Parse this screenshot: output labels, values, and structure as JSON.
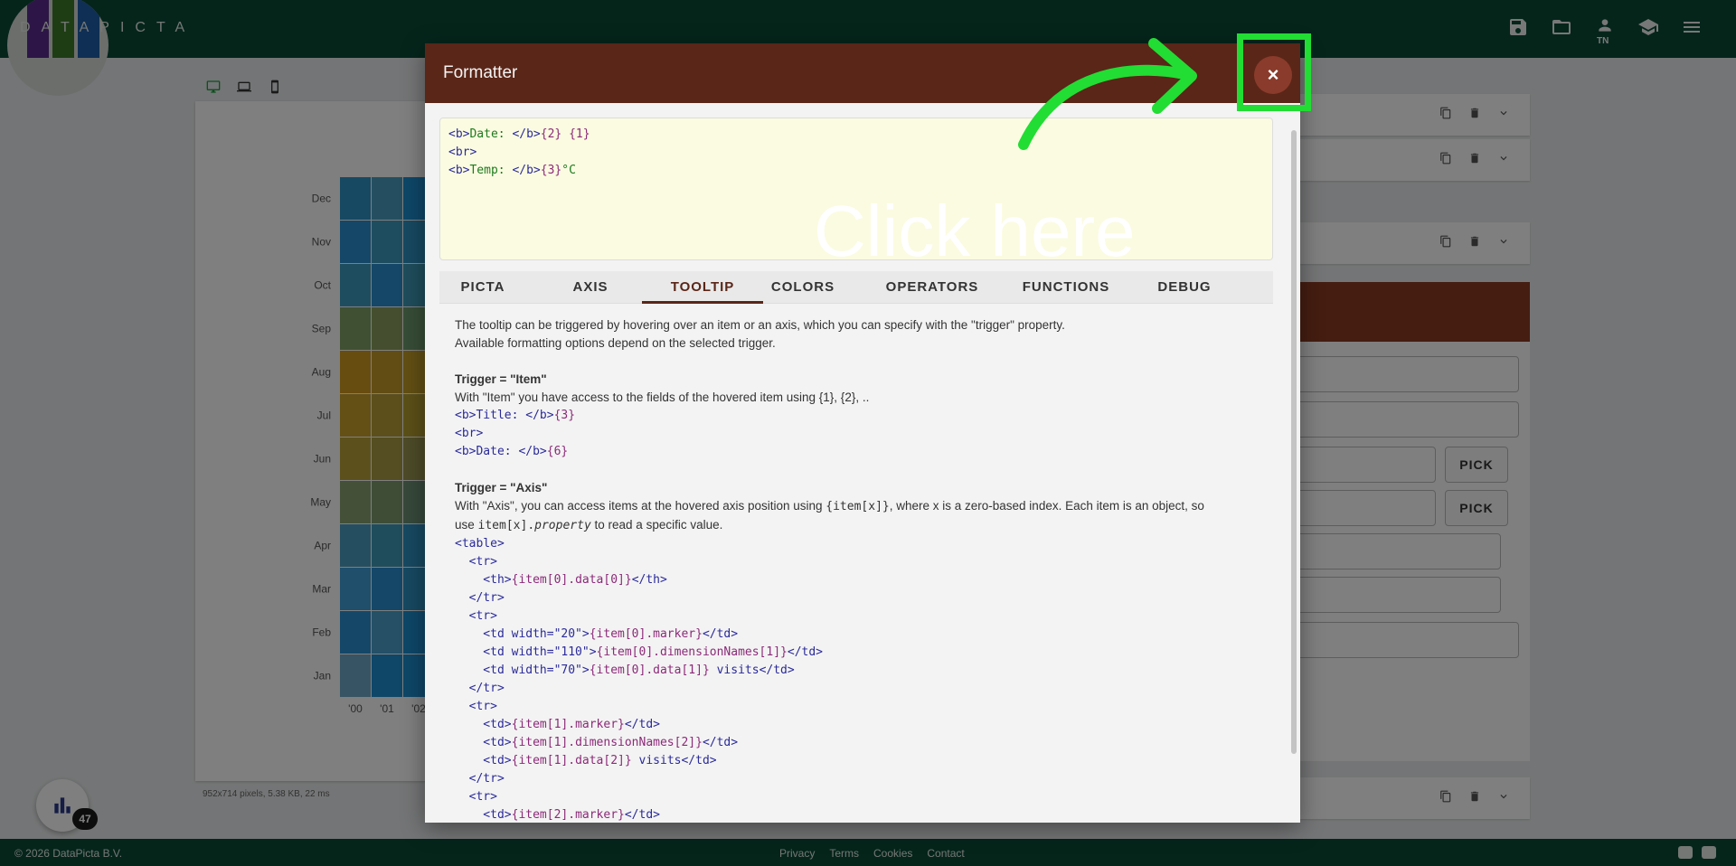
{
  "app": {
    "logo_text": "DATAPICTA",
    "logo_colors": [
      "#5b2d8e",
      "#3f7a2a",
      "#1e5fa8"
    ],
    "user_initials": "TN"
  },
  "toolbar": {
    "icons": [
      "save-icon",
      "folder-open-icon",
      "user-icon",
      "graduation-cap-icon",
      "menu-icon"
    ]
  },
  "chart": {
    "y_labels": [
      "Dec",
      "Nov",
      "Oct",
      "Sep",
      "Aug",
      "Jul",
      "Jun",
      "May",
      "Apr",
      "Mar",
      "Feb",
      "Jan"
    ],
    "x_labels": [
      "'00",
      "'01",
      "'02"
    ],
    "pixel_info": "952x714 pixels, 5.38 KB, 22 ms"
  },
  "chart_data": {
    "type": "heatmap",
    "x": [
      "'00",
      "'01",
      "'02"
    ],
    "y": [
      "Jan",
      "Feb",
      "Mar",
      "Apr",
      "May",
      "Jun",
      "Jul",
      "Aug",
      "Sep",
      "Oct",
      "Nov",
      "Dec"
    ],
    "cell_colors": [
      [
        "#6fa8c8",
        "#1c8fd0",
        "#1c8fd0"
      ],
      [
        "#2a8fd0",
        "#4aa0cc",
        "#1c8fd0"
      ],
      [
        "#3f9fd6",
        "#2a8fd0",
        "#2f93c4"
      ],
      [
        "#4a9fc0",
        "#3f9ab8",
        "#2f93c4"
      ],
      [
        "#8aa070",
        "#7e9a6e",
        "#6f9276"
      ],
      [
        "#b8a23a",
        "#a89c45",
        "#9a9650"
      ],
      [
        "#c9a028",
        "#b89e38",
        "#b8a030"
      ],
      [
        "#d09a20",
        "#c49a28",
        "#c49e28"
      ],
      [
        "#7ea066",
        "#8a9e5e",
        "#6f9a6e"
      ],
      [
        "#3f9bc0",
        "#2a8fd0",
        "#3f9ab8"
      ],
      [
        "#2a8fd0",
        "#3f9bc0",
        "#2f93c4"
      ],
      [
        "#2f93c4",
        "#4a9fc0",
        "#1c8fd0"
      ]
    ]
  },
  "right_panel": {
    "tooltip_field_value": "<br><b>Temp: </b>{3}°C",
    "pick_label": "PICK"
  },
  "fab": {
    "badge": "47"
  },
  "footer": {
    "copyright": "© 2026 DataPicta B.V.",
    "links": [
      "Privacy",
      "Terms",
      "Cookies",
      "Contact"
    ]
  },
  "dialog": {
    "title": "Formatter",
    "close_label": "×",
    "code_lines": [
      [
        [
          "tag",
          "<b>"
        ],
        [
          "txt",
          "Date: "
        ],
        [
          "tag",
          "</b>"
        ],
        [
          "ph",
          "{2} {1}"
        ]
      ],
      [
        [
          "tag",
          "<br>"
        ]
      ],
      [
        [
          "tag",
          "<b>"
        ],
        [
          "txt",
          "Temp: "
        ],
        [
          "tag",
          "</b>"
        ],
        [
          "ph",
          "{3}"
        ],
        [
          "txt",
          "°C"
        ]
      ]
    ],
    "tabs": [
      "PICTA",
      "AXIS",
      "TOOLTIP",
      "COLORS",
      "OPERATORS",
      "FUNCTIONS",
      "DEBUG"
    ],
    "active_tab": "TOOLTIP",
    "help": {
      "intro1": "The tooltip can be triggered by hovering over an item or an axis, which you can specify with the \"trigger\" property.",
      "intro2": "Available formatting options depend on the selected trigger.",
      "item_heading": "Trigger = \"Item\"",
      "item_desc": "With \"Item\" you have access to the fields of the hovered item using {1}, {2}, ..",
      "item_code": [
        [
          [
            "tag",
            "<b>"
          ],
          [
            "tag",
            "Title: "
          ],
          [
            "tag",
            "</b>"
          ],
          [
            "ph",
            "{3}"
          ]
        ],
        [
          [
            "tag",
            "<br>"
          ]
        ],
        [
          [
            "tag",
            "<b>"
          ],
          [
            "tag",
            "Date: "
          ],
          [
            "tag",
            "</b>"
          ],
          [
            "ph",
            "{6}"
          ]
        ]
      ],
      "axis_heading": "Trigger = \"Axis\"",
      "axis_desc_a": "With \"Axis\", you can access items at the hovered axis position using ",
      "axis_desc_code1": "{item[x]}",
      "axis_desc_b": ", where x is a zero-based index. Each item is an object, so",
      "axis_desc_c": "use ",
      "axis_desc_code2a": "item[x].",
      "axis_desc_code2b": "property",
      "axis_desc_d": " to read a specific value.",
      "axis_code": [
        [
          [
            "tag",
            "<table>"
          ]
        ],
        [
          [
            "tag",
            "  <tr>"
          ]
        ],
        [
          [
            "tag",
            "    <th>"
          ],
          [
            "ph",
            "{item[0].data[0]}"
          ],
          [
            "tag",
            "</th>"
          ]
        ],
        [
          [
            "tag",
            "  </tr>"
          ]
        ],
        [
          [
            "tag",
            "  <tr>"
          ]
        ],
        [
          [
            "tag",
            "    <td width=\"20\">"
          ],
          [
            "ph",
            "{item[0].marker}"
          ],
          [
            "tag",
            "</td>"
          ]
        ],
        [
          [
            "tag",
            "    <td width=\"110\">"
          ],
          [
            "ph",
            "{item[0].dimensionNames[1]}"
          ],
          [
            "tag",
            "</td>"
          ]
        ],
        [
          [
            "tag",
            "    <td width=\"70\">"
          ],
          [
            "ph",
            "{item[0].data[1]}"
          ],
          [
            "tag",
            " visits</td>"
          ]
        ],
        [
          [
            "tag",
            "  </tr>"
          ]
        ],
        [
          [
            "tag",
            "  <tr>"
          ]
        ],
        [
          [
            "tag",
            "    <td>"
          ],
          [
            "ph",
            "{item[1].marker}"
          ],
          [
            "tag",
            "</td>"
          ]
        ],
        [
          [
            "tag",
            "    <td>"
          ],
          [
            "ph",
            "{item[1].dimensionNames[2]}"
          ],
          [
            "tag",
            "</td>"
          ]
        ],
        [
          [
            "tag",
            "    <td>"
          ],
          [
            "ph",
            "{item[1].data[2]}"
          ],
          [
            "tag",
            " visits</td>"
          ]
        ],
        [
          [
            "tag",
            "  </tr>"
          ]
        ],
        [
          [
            "tag",
            "  <tr>"
          ]
        ],
        [
          [
            "tag",
            "    <td>"
          ],
          [
            "ph",
            "{item[2].marker}"
          ],
          [
            "tag",
            "</td>"
          ]
        ]
      ]
    }
  },
  "annotation": {
    "text": "Click here",
    "color": "#22dd33"
  }
}
